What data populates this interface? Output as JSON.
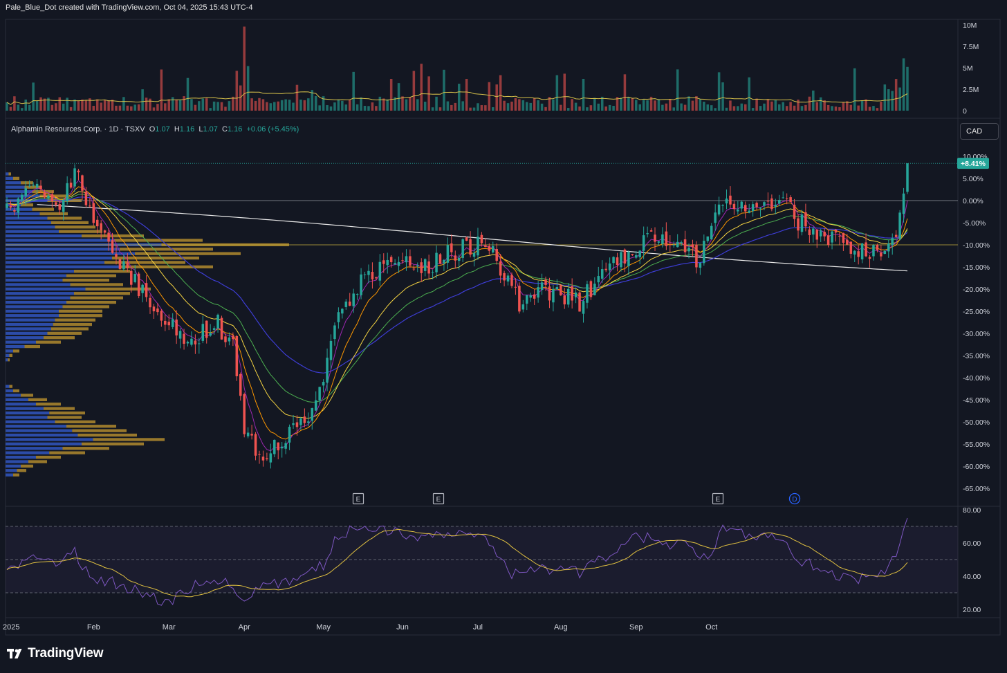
{
  "header": {
    "created_by": "Pale_Blue_Dot created with TradingView.com, Oct 04, 2025 15:43 UTC-4"
  },
  "legend": {
    "title": "Alphamin Resources Corp. · 1D · TSXV",
    "open_key": "O",
    "open": "1.07",
    "high_key": "H",
    "high": "1.16",
    "low_key": "L",
    "low": "1.07",
    "close_key": "C",
    "close": "1.16",
    "change": "+0.06 (+5.45%)"
  },
  "currency_button": "CAD",
  "price_badge": "+8.41%",
  "footer": {
    "brand": "TradingView"
  },
  "colors": {
    "bg": "#131722",
    "up": "#26a69a",
    "down": "#ef5350",
    "vol_up": "#26a69a",
    "vol_down": "#ef5350",
    "vol_ma": "#d7c14a",
    "ema_purple": "#9c27b0",
    "ema_orange": "#ff9800",
    "ema_yellow": "#f5d442",
    "ema_green": "#4caf50",
    "ema_blue": "#3d3dd4",
    "sma_white": "#e8e8e8",
    "vp_blue": "#2c4ca8",
    "vp_gold": "#b08a2e",
    "rsi": "#7e57c2",
    "rsi_ma": "#e0c040",
    "accent": "#26a69a"
  },
  "chart_data": [
    {
      "type": "bar",
      "name": "volume",
      "ticks": [
        "10M",
        "7.5M",
        "5M",
        "2.5M",
        "0"
      ],
      "ylim": [
        0,
        10000000
      ]
    },
    {
      "type": "candlestick",
      "name": "price",
      "scale": "percent",
      "ticks": [
        "10.00%",
        "5.00%",
        "0.00%",
        "-5.00%",
        "-10.00%",
        "-15.00%",
        "-20.00%",
        "-25.00%",
        "-30.00%",
        "-35.00%",
        "-40.00%",
        "-45.00%",
        "-50.00%",
        "-55.00%",
        "-60.00%",
        "-65.00%"
      ],
      "ylim": [
        -67,
        11
      ],
      "last_change_pct": 8.41,
      "events": [
        "E",
        "E",
        "E",
        "D"
      ],
      "anchors": [
        {
          "d": 0,
          "v": -2
        },
        {
          "d": 8,
          "v": 3
        },
        {
          "d": 14,
          "v": -3
        },
        {
          "d": 18,
          "v": 7
        },
        {
          "d": 22,
          "v": -1
        },
        {
          "d": 28,
          "v": -12
        },
        {
          "d": 33,
          "v": -18
        },
        {
          "d": 38,
          "v": -22
        },
        {
          "d": 42,
          "v": -28
        },
        {
          "d": 47,
          "v": -31
        },
        {
          "d": 52,
          "v": -30
        },
        {
          "d": 56,
          "v": -28
        },
        {
          "d": 60,
          "v": -33
        },
        {
          "d": 63,
          "v": -52
        },
        {
          "d": 67,
          "v": -57
        },
        {
          "d": 72,
          "v": -55
        },
        {
          "d": 77,
          "v": -51
        },
        {
          "d": 82,
          "v": -47
        },
        {
          "d": 87,
          "v": -27
        },
        {
          "d": 92,
          "v": -21
        },
        {
          "d": 97,
          "v": -16
        },
        {
          "d": 103,
          "v": -12
        },
        {
          "d": 110,
          "v": -15
        },
        {
          "d": 116,
          "v": -13
        },
        {
          "d": 122,
          "v": -10
        },
        {
          "d": 128,
          "v": -11
        },
        {
          "d": 132,
          "v": -16
        },
        {
          "d": 136,
          "v": -23
        },
        {
          "d": 141,
          "v": -19
        },
        {
          "d": 146,
          "v": -21
        },
        {
          "d": 152,
          "v": -23
        },
        {
          "d": 156,
          "v": -19
        },
        {
          "d": 161,
          "v": -15
        },
        {
          "d": 166,
          "v": -10
        },
        {
          "d": 172,
          "v": -9
        },
        {
          "d": 178,
          "v": -11
        },
        {
          "d": 184,
          "v": -13
        },
        {
          "d": 189,
          "v": -2
        },
        {
          "d": 194,
          "v": 0
        },
        {
          "d": 200,
          "v": -1
        },
        {
          "d": 206,
          "v": 0
        },
        {
          "d": 210,
          "v": -5
        },
        {
          "d": 216,
          "v": -7
        },
        {
          "d": 222,
          "v": -9
        },
        {
          "d": 227,
          "v": -11
        },
        {
          "d": 232,
          "v": -13
        },
        {
          "d": 236,
          "v": -8
        },
        {
          "d": 238,
          "v": 1
        },
        {
          "d": 239,
          "v": 8
        }
      ]
    },
    {
      "type": "line",
      "name": "rsi",
      "ticks": [
        "80.00",
        "60.00",
        "40.00",
        "20.00"
      ],
      "ylim": [
        18,
        82
      ],
      "band": [
        30,
        70
      ],
      "mid": 50,
      "anchors": [
        {
          "d": 0,
          "v": 42
        },
        {
          "d": 8,
          "v": 52
        },
        {
          "d": 14,
          "v": 48
        },
        {
          "d": 18,
          "v": 54
        },
        {
          "d": 22,
          "v": 40
        },
        {
          "d": 30,
          "v": 35
        },
        {
          "d": 38,
          "v": 28
        },
        {
          "d": 42,
          "v": 24
        },
        {
          "d": 47,
          "v": 30
        },
        {
          "d": 52,
          "v": 38
        },
        {
          "d": 58,
          "v": 36
        },
        {
          "d": 62,
          "v": 26
        },
        {
          "d": 66,
          "v": 32
        },
        {
          "d": 72,
          "v": 36
        },
        {
          "d": 78,
          "v": 40
        },
        {
          "d": 84,
          "v": 47
        },
        {
          "d": 88,
          "v": 65
        },
        {
          "d": 96,
          "v": 70
        },
        {
          "d": 104,
          "v": 66
        },
        {
          "d": 112,
          "v": 64
        },
        {
          "d": 120,
          "v": 66
        },
        {
          "d": 128,
          "v": 62
        },
        {
          "d": 134,
          "v": 42
        },
        {
          "d": 140,
          "v": 46
        },
        {
          "d": 146,
          "v": 44
        },
        {
          "d": 152,
          "v": 42
        },
        {
          "d": 158,
          "v": 50
        },
        {
          "d": 166,
          "v": 66
        },
        {
          "d": 174,
          "v": 60
        },
        {
          "d": 180,
          "v": 58
        },
        {
          "d": 186,
          "v": 50
        },
        {
          "d": 190,
          "v": 68
        },
        {
          "d": 196,
          "v": 66
        },
        {
          "d": 204,
          "v": 64
        },
        {
          "d": 210,
          "v": 50
        },
        {
          "d": 216,
          "v": 44
        },
        {
          "d": 222,
          "v": 40
        },
        {
          "d": 228,
          "v": 38
        },
        {
          "d": 233,
          "v": 44
        },
        {
          "d": 236,
          "v": 54
        },
        {
          "d": 238,
          "v": 68
        },
        {
          "d": 239,
          "v": 75
        }
      ]
    }
  ],
  "x_axis": {
    "labels": [
      "2025",
      "Feb",
      "Mar",
      "Apr",
      "May",
      "Jun",
      "Jul",
      "Aug",
      "Sep",
      "Oct"
    ],
    "label_days": [
      0,
      23,
      43,
      63,
      84,
      105,
      125,
      147,
      167,
      187
    ]
  }
}
